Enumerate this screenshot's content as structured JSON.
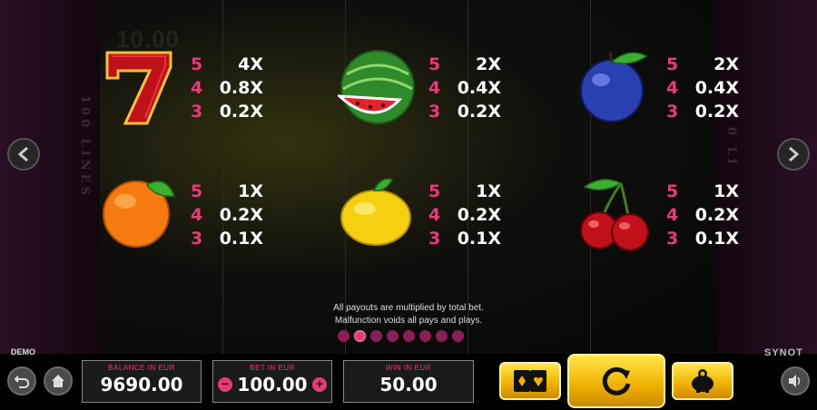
{
  "background": {
    "faded_number": "10.00",
    "lines_left": "100 LINES",
    "lines_right": "0 LI"
  },
  "paytable": [
    {
      "symbol": "seven-icon",
      "rows": [
        {
          "count": "5",
          "mult": "4X"
        },
        {
          "count": "4",
          "mult": "0.8X"
        },
        {
          "count": "3",
          "mult": "0.2X"
        }
      ]
    },
    {
      "symbol": "watermelon-icon",
      "rows": [
        {
          "count": "5",
          "mult": "2X"
        },
        {
          "count": "4",
          "mult": "0.4X"
        },
        {
          "count": "3",
          "mult": "0.2X"
        }
      ]
    },
    {
      "symbol": "plum-icon",
      "rows": [
        {
          "count": "5",
          "mult": "2X"
        },
        {
          "count": "4",
          "mult": "0.4X"
        },
        {
          "count": "3",
          "mult": "0.2X"
        }
      ]
    },
    {
      "symbol": "orange-icon",
      "rows": [
        {
          "count": "5",
          "mult": "1X"
        },
        {
          "count": "4",
          "mult": "0.2X"
        },
        {
          "count": "3",
          "mult": "0.1X"
        }
      ]
    },
    {
      "symbol": "lemon-icon",
      "rows": [
        {
          "count": "5",
          "mult": "1X"
        },
        {
          "count": "4",
          "mult": "0.2X"
        },
        {
          "count": "3",
          "mult": "0.1X"
        }
      ]
    },
    {
      "symbol": "cherry-icon",
      "rows": [
        {
          "count": "5",
          "mult": "1X"
        },
        {
          "count": "4",
          "mult": "0.2X"
        },
        {
          "count": "3",
          "mult": "0.1X"
        }
      ]
    }
  ],
  "disclaimer": {
    "line1": "All payouts are multiplied by total bet.",
    "line2": "Malfunction voids all pays and plays."
  },
  "pagination": {
    "total": 8,
    "active": 2
  },
  "footer": {
    "demo_label": "DEMO",
    "brand": "SYNOT",
    "balance": {
      "label": "BALANCE IN EUR",
      "value": "9690.00"
    },
    "bet": {
      "label": "BET IN EUR",
      "value": "100.00",
      "minus": "−",
      "plus": "+"
    },
    "win": {
      "label": "WIN IN EUR",
      "value": "50.00"
    }
  },
  "colors": {
    "accent": "#e83a7a",
    "gold": "#f0b000",
    "frame": "#2a0f25"
  }
}
